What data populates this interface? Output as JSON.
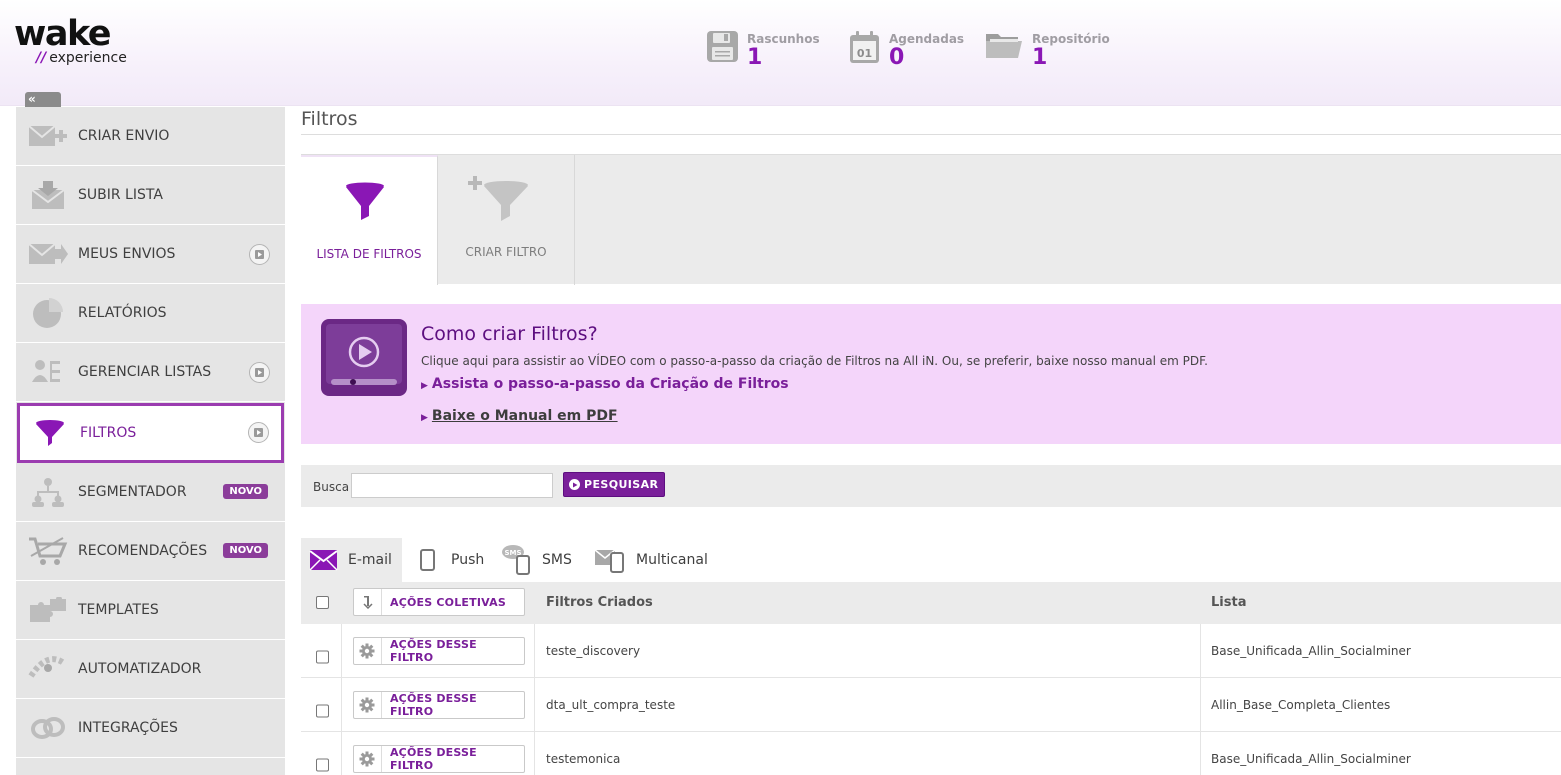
{
  "brand": {
    "logo_main": "wake",
    "logo_slashes": "//",
    "logo_sub": "experience"
  },
  "header_stats": [
    {
      "label": "Rascunhos",
      "value": "1",
      "icon": "floppy-disk-icon"
    },
    {
      "label": "Agendadas",
      "value": "0",
      "icon": "calendar-icon",
      "icon_text": "01"
    },
    {
      "label": "Repositório",
      "value": "1",
      "icon": "folder-icon"
    }
  ],
  "collapse_label": "«",
  "sidebar": {
    "items": [
      {
        "label": "CRIAR ENVIO",
        "icon": "create-send-icon"
      },
      {
        "label": "SUBIR LISTA",
        "icon": "upload-list-icon"
      },
      {
        "label": "MEUS ENVIOS",
        "icon": "my-sends-icon",
        "has_video": true
      },
      {
        "label": "RELATÓRIOS",
        "icon": "pie-chart-icon"
      },
      {
        "label": "GERENCIAR LISTAS",
        "icon": "manage-lists-icon",
        "has_video": true
      },
      {
        "label": "FILTROS",
        "icon": "funnel-icon",
        "has_video": true,
        "active": true
      },
      {
        "label": "SEGMENTADOR",
        "icon": "org-chart-icon",
        "badge": "NOVO"
      },
      {
        "label": "RECOMENDAÇÕES",
        "icon": "cart-icon",
        "badge": "NOVO"
      },
      {
        "label": "TEMPLATES",
        "icon": "puzzle-icon"
      },
      {
        "label": "AUTOMATIZADOR",
        "icon": "automation-icon"
      },
      {
        "label": "INTEGRAÇÕES",
        "icon": "link-icon"
      }
    ]
  },
  "page_title": "Filtros",
  "big_tabs": [
    {
      "label": "LISTA DE FILTROS",
      "active": true
    },
    {
      "label": "CRIAR FILTRO",
      "active": false
    }
  ],
  "promo": {
    "title": "Como criar Filtros?",
    "description": "Clique aqui para assistir ao VÍDEO com o passo-a-passo da criação de Filtros na All iN. Ou, se preferir, baixe nosso manual em PDF.",
    "video_link": "Assista o passo-a-passo da Criação de Filtros",
    "pdf_link": "Baixe o Manual em PDF"
  },
  "search": {
    "label": "Busca",
    "value": "",
    "button": "PESQUISAR"
  },
  "channel_tabs": [
    {
      "label": "E-mail",
      "icon": "email-icon",
      "active": true
    },
    {
      "label": "Push",
      "icon": "mobile-icon"
    },
    {
      "label": "SMS",
      "icon": "sms-icon",
      "icon_text": "SMS"
    },
    {
      "label": "Multicanal",
      "icon": "multichannel-icon"
    }
  ],
  "table": {
    "bulk_actions": "AÇÕES COLETIVAS",
    "row_actions": "AÇÕES DESSE FILTRO",
    "columns": [
      "Filtros Criados",
      "Lista"
    ],
    "rows": [
      {
        "name": "teste_discovery",
        "list": "Base_Unificada_Allin_Socialminer"
      },
      {
        "name": "dta_ult_compra_teste",
        "list": "Allin_Base_Completa_Clientes"
      },
      {
        "name": "testemonica",
        "list": "Base_Unificada_Allin_Socialminer"
      }
    ]
  },
  "colors": {
    "accent": "#7a1f9a",
    "promo_bg": "#f4d5fa",
    "sidebar_bg": "#e5e5e5"
  }
}
